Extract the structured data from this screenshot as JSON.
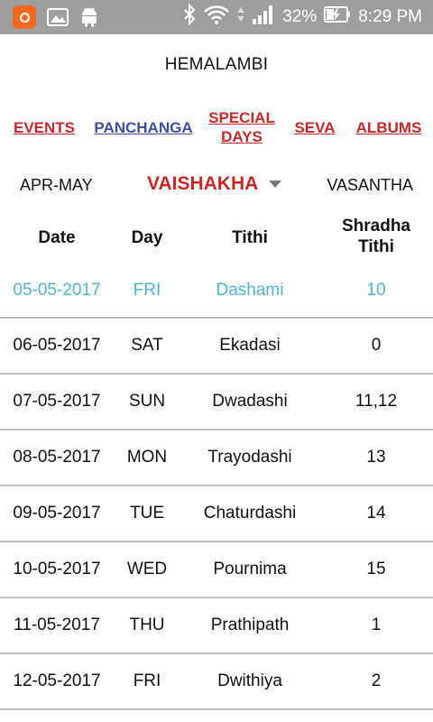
{
  "status_bar": {
    "battery": "32%",
    "time": "8:29 PM",
    "icons": [
      "app-notification-icon",
      "image-icon",
      "android-icon",
      "bluetooth-icon",
      "wifi-icon",
      "signal-icon",
      "battery-charging-icon"
    ]
  },
  "header": {
    "title": "HEMALAMBI"
  },
  "nav": {
    "events": "EVENTS",
    "panchanga": "PANCHANGA",
    "special_days_line1": "SPECIAL",
    "special_days_line2": "DAYS",
    "seva": "SEVA",
    "albums": "ALBUMS"
  },
  "month_row": {
    "left": "APR-MAY",
    "selected_month": "VAISHAKHA",
    "right": "VASANTHA"
  },
  "table": {
    "headers": {
      "date": "Date",
      "day": "Day",
      "tithi": "Tithi",
      "shradha_line1": "Shradha",
      "shradha_line2": "Tithi"
    },
    "rows": [
      {
        "date": "05-05-2017",
        "day": "FRI",
        "tithi": "Dashami",
        "shradha": "10",
        "highlighted": true
      },
      {
        "date": "06-05-2017",
        "day": "SAT",
        "tithi": "Ekadasi",
        "shradha": "0"
      },
      {
        "date": "07-05-2017",
        "day": "SUN",
        "tithi": "Dwadashi",
        "shradha": "11,12"
      },
      {
        "date": "08-05-2017",
        "day": "MON",
        "tithi": "Trayodashi",
        "shradha": "13"
      },
      {
        "date": "09-05-2017",
        "day": "TUE",
        "tithi": "Chaturdashi",
        "shradha": "14"
      },
      {
        "date": "10-05-2017",
        "day": "WED",
        "tithi": "Pournima",
        "shradha": "15"
      },
      {
        "date": "11-05-2017",
        "day": "THU",
        "tithi": "Prathipath",
        "shradha": "1"
      },
      {
        "date": "12-05-2017",
        "day": "FRI",
        "tithi": "Dwithiya",
        "shradha": "2"
      }
    ]
  },
  "colors": {
    "accent_red": "#c62828",
    "accent_blue": "#3f4fa0",
    "highlight_row": "#4fb3d9",
    "status_bar": "#9e9e9e"
  }
}
